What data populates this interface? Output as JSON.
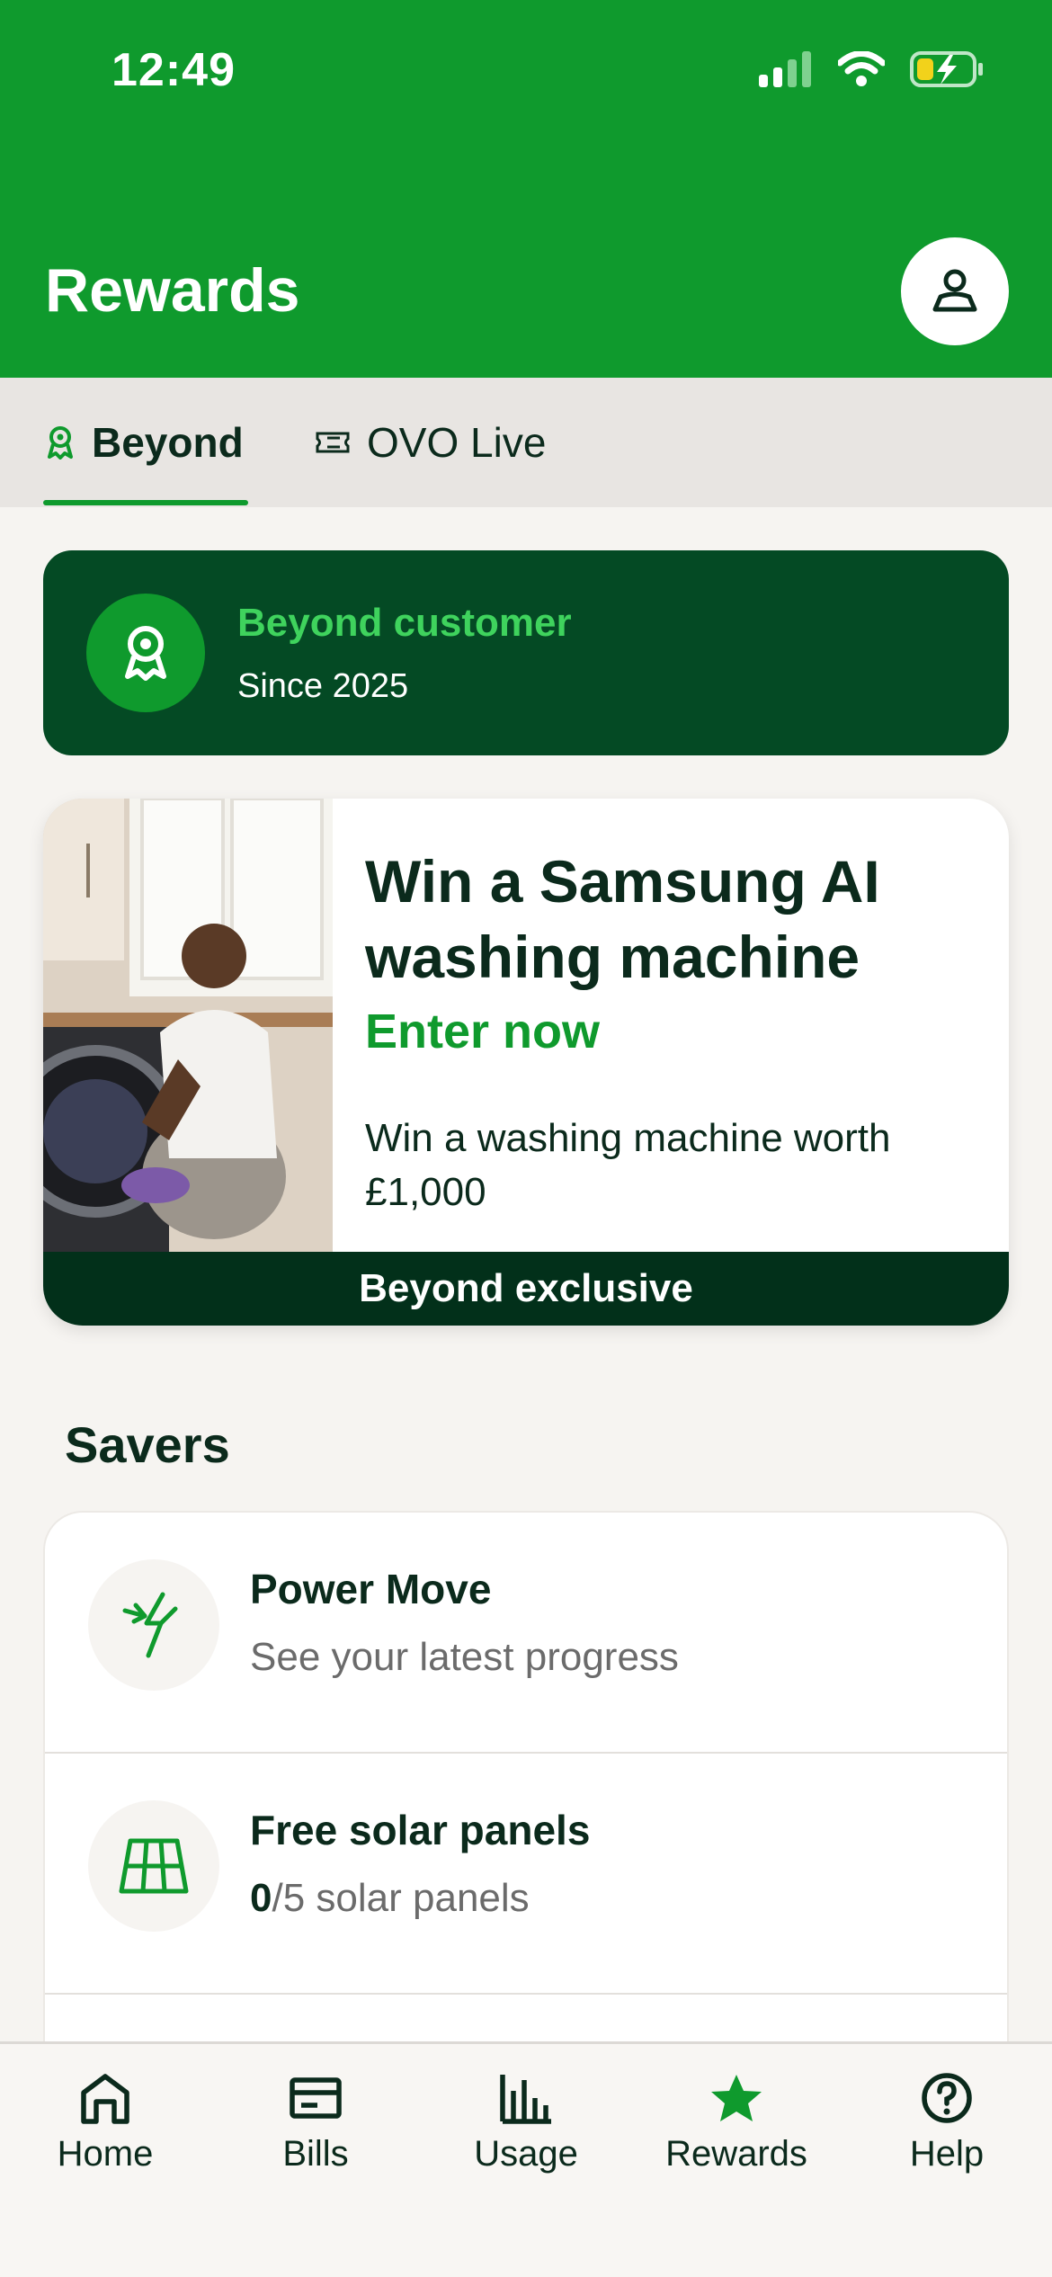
{
  "status": {
    "time": "12:49"
  },
  "header": {
    "title": "Rewards"
  },
  "tabs": [
    {
      "label": "Beyond",
      "active": true
    },
    {
      "label": "OVO Live",
      "active": false
    }
  ],
  "member_card": {
    "title": "Beyond customer",
    "subtitle": "Since 2025"
  },
  "promo": {
    "title": "Win a Samsung AI washing machine",
    "cta": "Enter now",
    "description": "Win a washing machine worth £1,000",
    "banner": "Beyond exclusive"
  },
  "savers": {
    "section_title": "Savers",
    "items": [
      {
        "title": "Power Move",
        "subtitle": "See your latest progress",
        "icon": "lightning-arrow-icon"
      },
      {
        "title": "Free solar panels",
        "count": "0",
        "subtitle_rest": "/5 solar panels",
        "icon": "solar-panel-icon"
      }
    ]
  },
  "bottom_nav": [
    {
      "label": "Home",
      "icon": "home-icon"
    },
    {
      "label": "Bills",
      "icon": "bills-icon"
    },
    {
      "label": "Usage",
      "icon": "usage-chart-icon"
    },
    {
      "label": "Rewards",
      "icon": "star-icon",
      "active": true
    },
    {
      "label": "Help",
      "icon": "help-icon"
    }
  ],
  "colors": {
    "brand_green": "#0f9a2d",
    "dark_green": "#044a24",
    "accent_green": "#3fd35d",
    "text_dark": "#0b2a1c"
  }
}
